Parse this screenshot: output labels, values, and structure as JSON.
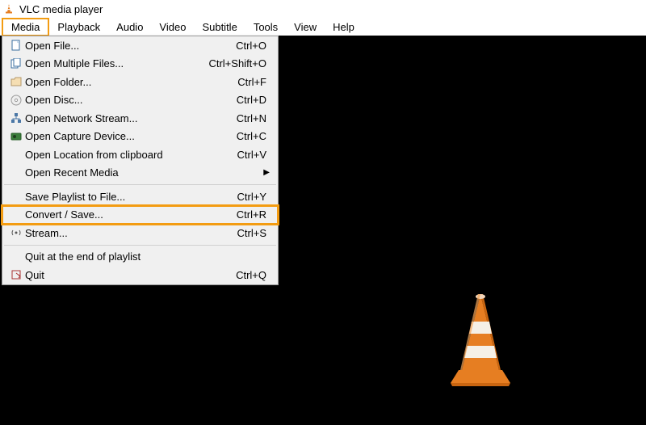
{
  "window": {
    "title": "VLC media player"
  },
  "menubar": [
    {
      "label": "Media",
      "highlighted": true
    },
    {
      "label": "Playback",
      "highlighted": false
    },
    {
      "label": "Audio",
      "highlighted": false
    },
    {
      "label": "Video",
      "highlighted": false
    },
    {
      "label": "Subtitle",
      "highlighted": false
    },
    {
      "label": "Tools",
      "highlighted": false
    },
    {
      "label": "View",
      "highlighted": false
    },
    {
      "label": "Help",
      "highlighted": false
    }
  ],
  "media_menu": {
    "groups": [
      [
        {
          "icon": "file-icon",
          "label": "Open File...",
          "shortcut": "Ctrl+O"
        },
        {
          "icon": "multifile-icon",
          "label": "Open Multiple Files...",
          "shortcut": "Ctrl+Shift+O"
        },
        {
          "icon": "folder-icon",
          "label": "Open Folder...",
          "shortcut": "Ctrl+F"
        },
        {
          "icon": "disc-icon",
          "label": "Open Disc...",
          "shortcut": "Ctrl+D"
        },
        {
          "icon": "network-icon",
          "label": "Open Network Stream...",
          "shortcut": "Ctrl+N"
        },
        {
          "icon": "capture-icon",
          "label": "Open Capture Device...",
          "shortcut": "Ctrl+C"
        },
        {
          "icon": "",
          "label": "Open Location from clipboard",
          "shortcut": "Ctrl+V"
        },
        {
          "icon": "",
          "label": "Open Recent Media",
          "shortcut": "",
          "submenu": true
        }
      ],
      [
        {
          "icon": "",
          "label": "Save Playlist to File...",
          "shortcut": "Ctrl+Y"
        },
        {
          "icon": "",
          "label": "Convert / Save...",
          "shortcut": "Ctrl+R",
          "highlighted": true
        },
        {
          "icon": "stream-icon",
          "label": "Stream...",
          "shortcut": "Ctrl+S"
        }
      ],
      [
        {
          "icon": "",
          "label": "Quit at the end of playlist",
          "shortcut": ""
        },
        {
          "icon": "quit-icon",
          "label": "Quit",
          "shortcut": "Ctrl+Q"
        }
      ]
    ]
  },
  "highlight_color": "#f39c12"
}
